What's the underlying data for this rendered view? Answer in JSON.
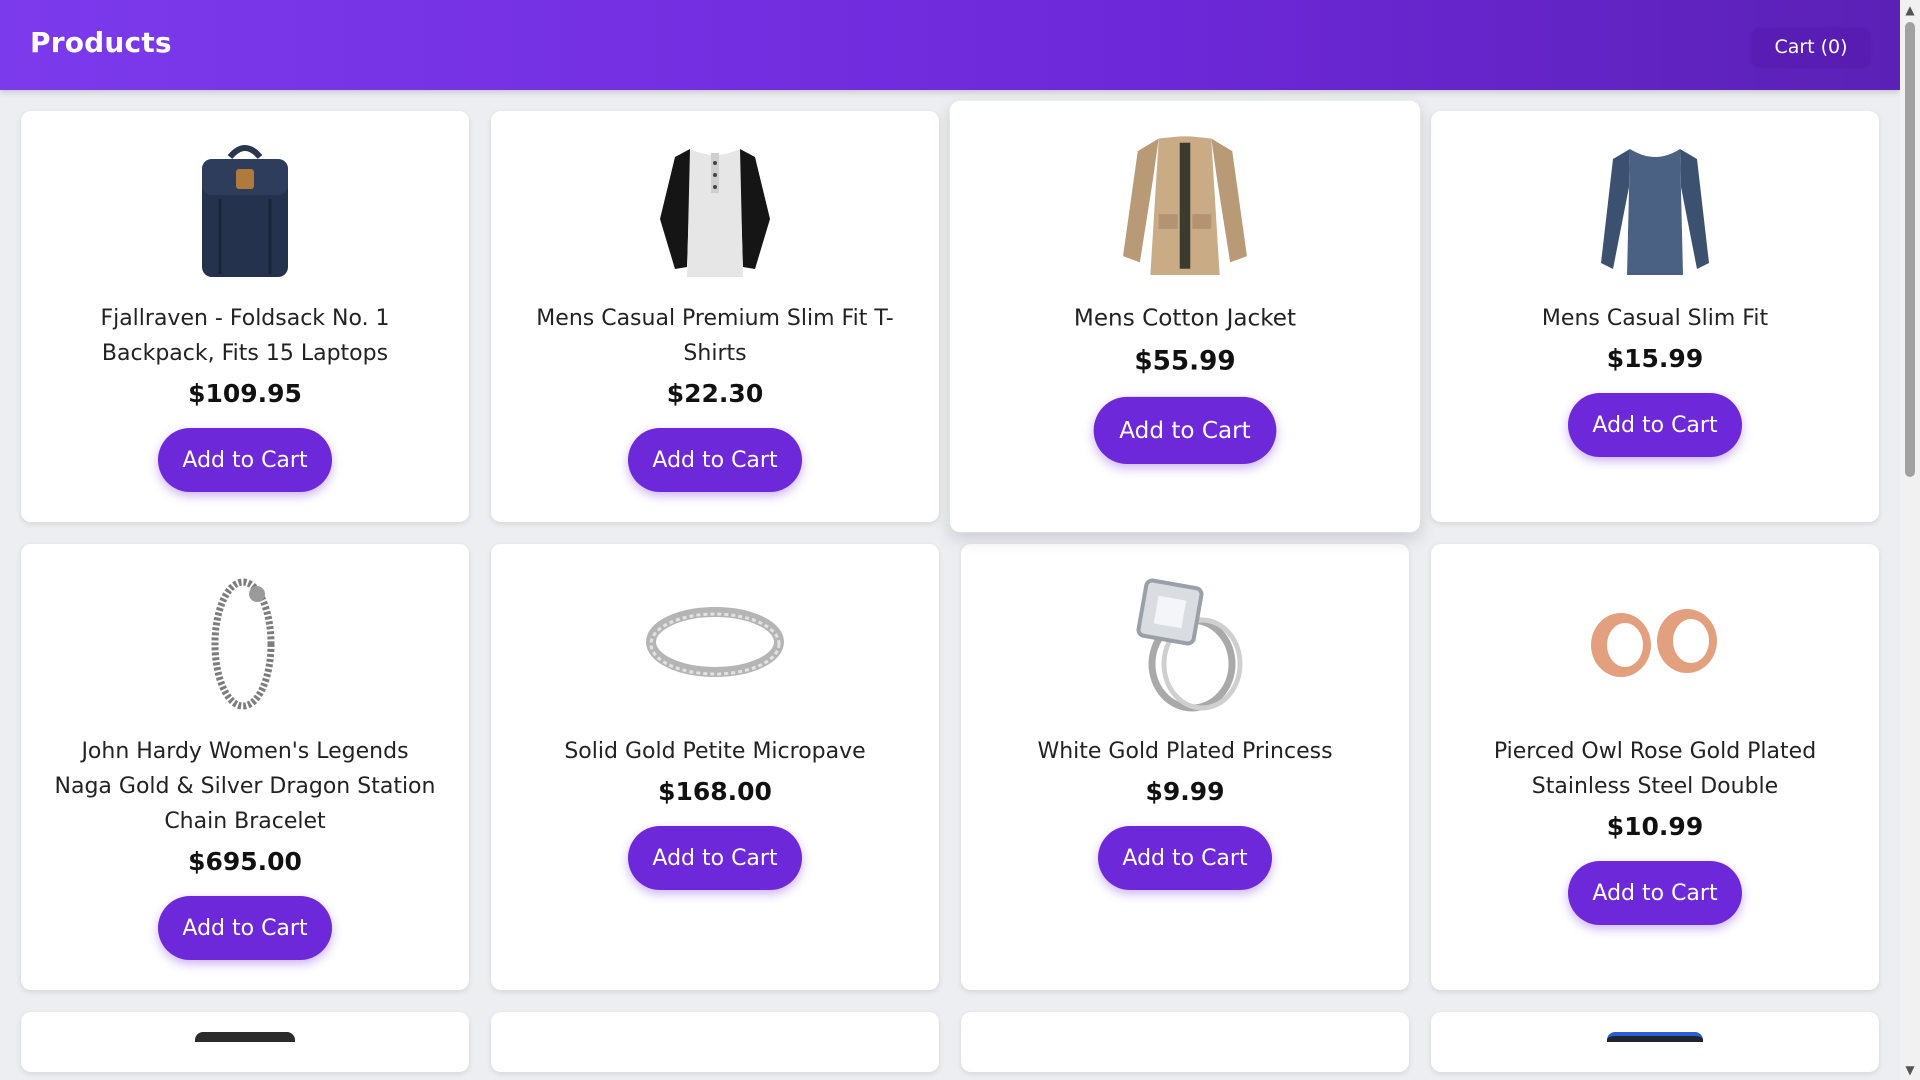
{
  "header": {
    "title": "Products",
    "cart_label": "Cart (0)"
  },
  "colors": {
    "accent": "#6d28d9",
    "header_start": "#7c3aed",
    "background": "#eceef2"
  },
  "products": [
    {
      "title": "Fjallraven - Foldsack No. 1 Backpack, Fits 15 Laptops",
      "price": "$109.95",
      "button": "Add to Cart",
      "icon": "backpack-icon"
    },
    {
      "title": "Mens Casual Premium Slim Fit T-Shirts",
      "price": "$22.30",
      "button": "Add to Cart",
      "icon": "tshirt-icon"
    },
    {
      "title": "Mens Cotton Jacket",
      "price": "$55.99",
      "button": "Add to Cart",
      "icon": "jacket-icon"
    },
    {
      "title": "Mens Casual Slim Fit",
      "price": "$15.99",
      "button": "Add to Cart",
      "icon": "longsleeve-icon"
    },
    {
      "title": "John Hardy Women's Legends Naga Gold & Silver Dragon Station Chain Bracelet",
      "price": "$695.00",
      "button": "Add to Cart",
      "icon": "bracelet-icon"
    },
    {
      "title": "Solid Gold Petite Micropave",
      "price": "$168.00",
      "button": "Add to Cart",
      "icon": "ring-icon"
    },
    {
      "title": "White Gold Plated Princess",
      "price": "$9.99",
      "button": "Add to Cart",
      "icon": "diamond-ring-icon"
    },
    {
      "title": "Pierced Owl Rose Gold Plated Stainless Steel Double",
      "price": "$10.99",
      "button": "Add to Cart",
      "icon": "earrings-icon"
    }
  ]
}
